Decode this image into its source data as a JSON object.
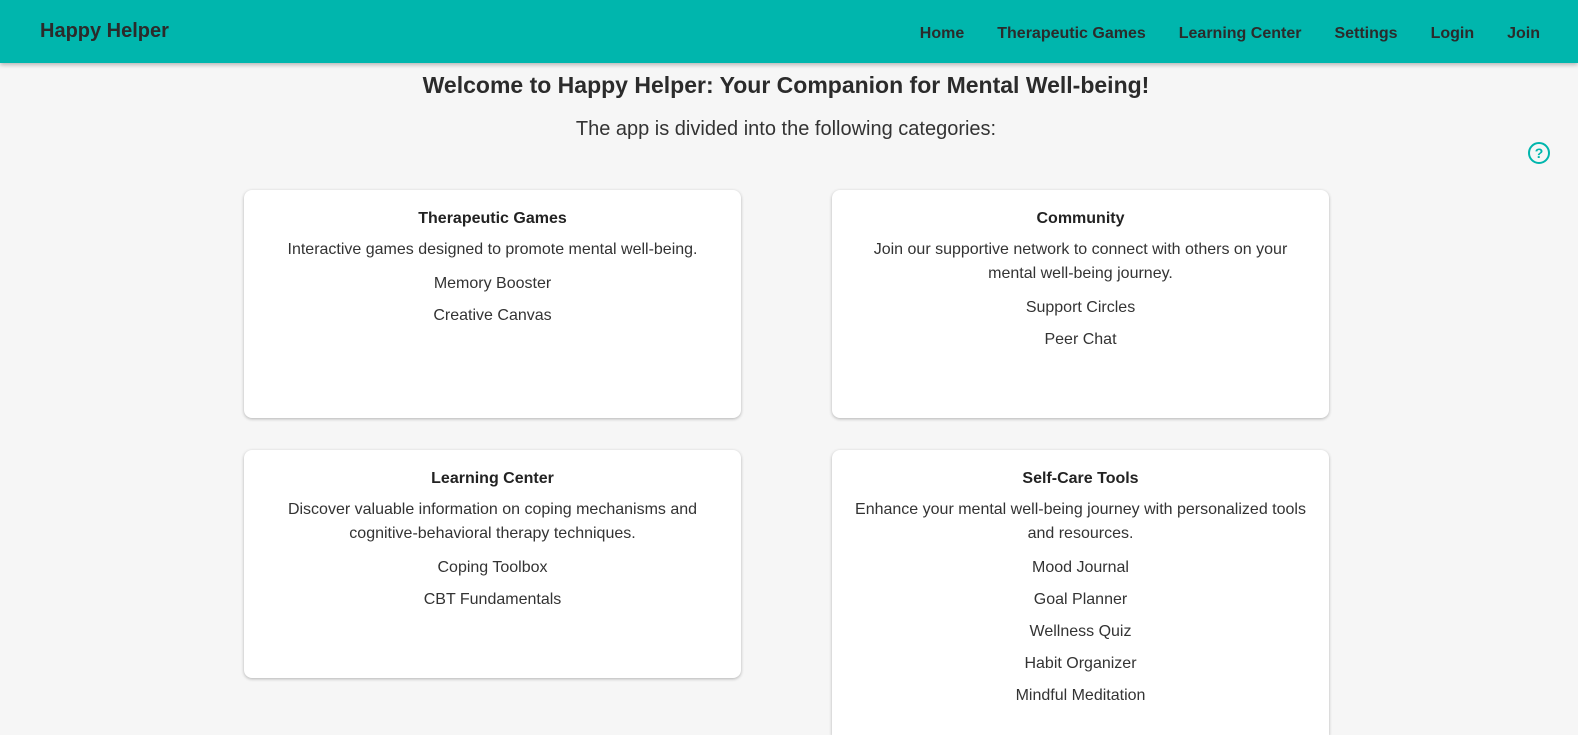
{
  "app": {
    "brand": "Happy Helper"
  },
  "nav": {
    "items": [
      "Home",
      "Therapeutic Games",
      "Learning Center",
      "Settings",
      "Login",
      "Join"
    ]
  },
  "hero": {
    "title": "Welcome to Happy Helper: Your Companion for Mental Well-being!",
    "subtitle": "The app is divided into the following categories:"
  },
  "help": {
    "icon": "help-circle-icon",
    "glyph": "?"
  },
  "colors": {
    "accent": "#00b6ad",
    "background": "#f6f6f6",
    "card": "#ffffff"
  },
  "cards": [
    {
      "title": "Therapeutic Games",
      "description": "Interactive games designed to promote mental well-being.",
      "links": [
        "Memory Booster",
        "Creative Canvas"
      ]
    },
    {
      "title": "Community",
      "description": "Join our supportive network to connect with others on your mental well-being journey.",
      "links": [
        "Support Circles",
        "Peer Chat"
      ]
    },
    {
      "title": "Learning Center",
      "description": "Discover valuable information on coping mechanisms and cognitive-behavioral therapy techniques.",
      "links": [
        "Coping Toolbox",
        "CBT Fundamentals"
      ]
    },
    {
      "title": "Self-Care Tools",
      "description": "Enhance your mental well-being journey with personalized tools and resources.",
      "links": [
        "Mood Journal",
        "Goal Planner",
        "Wellness Quiz",
        "Habit Organizer",
        "Mindful Meditation"
      ]
    }
  ]
}
